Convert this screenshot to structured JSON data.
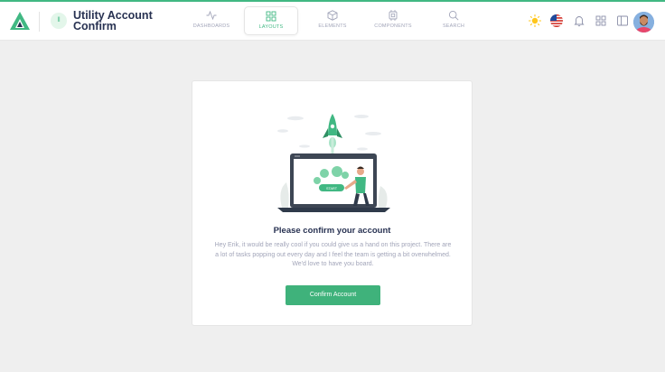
{
  "header": {
    "logo_icon": "vuero-triangle-logo",
    "breadcrumb_badge": "ll",
    "title": "Utility Account Confirm"
  },
  "nav": {
    "items": [
      {
        "label": "DASHBOARDS",
        "icon": "activity-icon"
      },
      {
        "label": "LAYOUTS",
        "icon": "grid-icon"
      },
      {
        "label": "ELEMENTS",
        "icon": "box-icon"
      },
      {
        "label": "COMPONENTS",
        "icon": "cpu-icon"
      },
      {
        "label": "SEARCH",
        "icon": "search-icon"
      }
    ],
    "active": "LAYOUTS"
  },
  "toolbar": {
    "icons": [
      "sun-icon",
      "us-flag-icon",
      "bell-icon",
      "apps-grid-icon",
      "sidebar-icon",
      "user-avatar"
    ]
  },
  "card": {
    "illustration_button": "START",
    "title": "Please confirm your account",
    "body": "Hey Erik, it would be really cool if you could give us a hand on this project. There are a lot of tasks popping out every day and I feel the team is getting a bit overwhelmed. We'd love to have you board.",
    "button_label": "Confirm Account"
  },
  "colors": {
    "accent": "#41b883",
    "button": "#3fb27b",
    "background": "#efefef",
    "text_dark": "#283252",
    "text_muted": "#a2a5b9"
  }
}
